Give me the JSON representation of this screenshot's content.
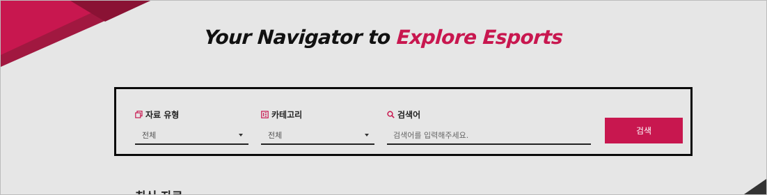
{
  "hero": {
    "title_part1": "Your Navigator to",
    "title_part2": "Explore Esports"
  },
  "search_panel": {
    "type_label": "자료 유형",
    "type_value": "전체",
    "category_label": "카테고리",
    "category_value": "전체",
    "keyword_label": "검색어",
    "keyword_placeholder": "검색어를 입력해주세요.",
    "search_button": "검색"
  },
  "section": {
    "recent_title": "최신 자료"
  },
  "colors": {
    "accent": "#c8174f",
    "background": "#e6e6e6",
    "text": "#111111"
  },
  "icons": [
    "documents-icon",
    "category-grid-icon",
    "search-icon",
    "dropdown-caret-icon"
  ]
}
